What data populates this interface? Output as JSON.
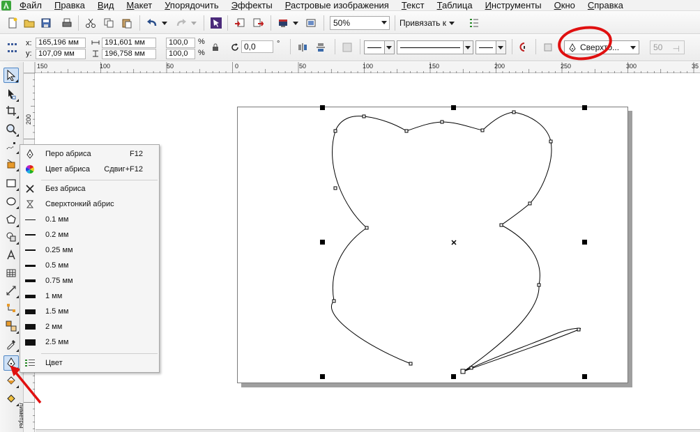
{
  "menubar": {
    "items": [
      {
        "label": "Файл",
        "ul": "Ф",
        "rest": "айл"
      },
      {
        "label": "Правка",
        "ul": "П",
        "rest": "равка"
      },
      {
        "label": "Вид",
        "ul": "В",
        "rest": "ид"
      },
      {
        "label": "Макет",
        "ul": "М",
        "rest": "акет"
      },
      {
        "label": "Упорядочить",
        "ul": "У",
        "rest": "порядочить"
      },
      {
        "label": "Эффекты",
        "ul": "Э",
        "rest": "ффекты"
      },
      {
        "label": "Растровые изображения",
        "ul": "Р",
        "rest": "астровые изображения"
      },
      {
        "label": "Текст",
        "ul": "Т",
        "rest": "екст"
      },
      {
        "label": "Таблица",
        "ul": "Т",
        "rest": "аблица"
      },
      {
        "label": "Инструменты",
        "ul": "И",
        "rest": "нструменты"
      },
      {
        "label": "Окно",
        "ul": "О",
        "rest": "кно"
      },
      {
        "label": "Справка",
        "ul": "С",
        "rest": "правка"
      }
    ]
  },
  "toolbar": {
    "zoom": "50%",
    "snap_label": "Привязать к"
  },
  "property_bar": {
    "x_label": "x:",
    "x_value": "165,196 мм",
    "y_label": "y:",
    "y_value": "107,09 мм",
    "width_value": "191,601 мм",
    "height_value": "196,758 мм",
    "scale_x": "100,0",
    "scale_y": "100,0",
    "percent": "%",
    "rotation": "0,0",
    "degree": "°",
    "outline_width": "Сверхто...",
    "disabled_value": "50"
  },
  "ruler": {
    "top_ticks": [
      "150",
      "100",
      "50",
      "0",
      "50",
      "100",
      "150",
      "200",
      "250",
      "300",
      "35"
    ],
    "left_ticks": [
      "200"
    ],
    "side_text": "лиметры"
  },
  "outline_flyout": {
    "items": [
      {
        "label": "Перо абриса",
        "shortcut": "F12"
      },
      {
        "label": "Цвет абриса",
        "shortcut": "Сдвиг+F12"
      },
      {
        "label": "Без абриса"
      },
      {
        "label": "Сверхтонкий абрис"
      },
      {
        "label": "0.1 мм"
      },
      {
        "label": "0.2 мм"
      },
      {
        "label": "0.25 мм"
      },
      {
        "label": "0.5 мм"
      },
      {
        "label": "0.75 мм"
      },
      {
        "label": "1 мм"
      },
      {
        "label": "1.5 мм"
      },
      {
        "label": "2 мм"
      },
      {
        "label": "2.5 мм"
      },
      {
        "label": "Цвет"
      }
    ]
  },
  "colors": {
    "annotation": "#e01010",
    "active_tool": "#cfe1f6"
  }
}
